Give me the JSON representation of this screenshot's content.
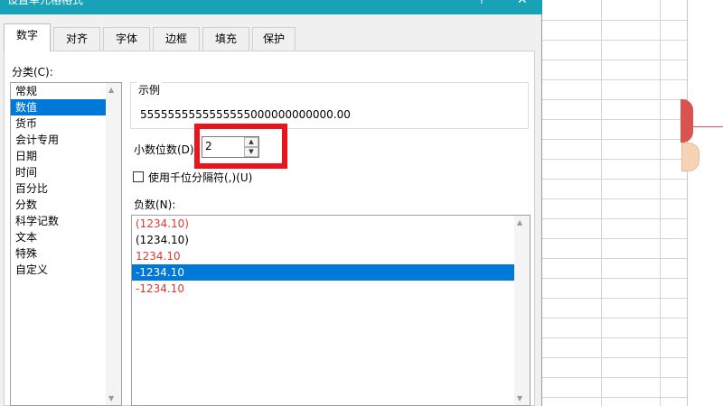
{
  "window": {
    "title": "设置单元格格式",
    "help_glyph": "?",
    "close_glyph": "✕"
  },
  "tabs": [
    {
      "label": "数字",
      "active": true
    },
    {
      "label": "对齐"
    },
    {
      "label": "字体"
    },
    {
      "label": "边框"
    },
    {
      "label": "填充"
    },
    {
      "label": "保护"
    }
  ],
  "category": {
    "label": "分类(C):",
    "items": [
      "常规",
      "数值",
      "货币",
      "会计专用",
      "日期",
      "时间",
      "百分比",
      "分数",
      "科学记数",
      "文本",
      "特殊",
      "自定义"
    ],
    "selected": "数值"
  },
  "sample": {
    "caption": "示例",
    "value": "5555555555555555000000000000.00"
  },
  "decimal_places": {
    "label": "小数位数(D):",
    "value": "2"
  },
  "thousands_separator": {
    "label": "使用千位分隔符(,)(U)",
    "checked": false
  },
  "negative_numbers": {
    "label": "负数(N):",
    "items": [
      {
        "text": "(1234.10)",
        "red": true
      },
      {
        "text": "(1234.10)",
        "red": false
      },
      {
        "text": "1234.10",
        "red": true
      },
      {
        "text": "-1234.10",
        "red": false,
        "selected": true
      },
      {
        "text": "-1234.10",
        "red": true
      }
    ]
  },
  "colors": {
    "accent": "#0078d7",
    "titlebar": "#18a2b8",
    "highlight": "#e8151f",
    "negative_red": "#e03a2b"
  }
}
